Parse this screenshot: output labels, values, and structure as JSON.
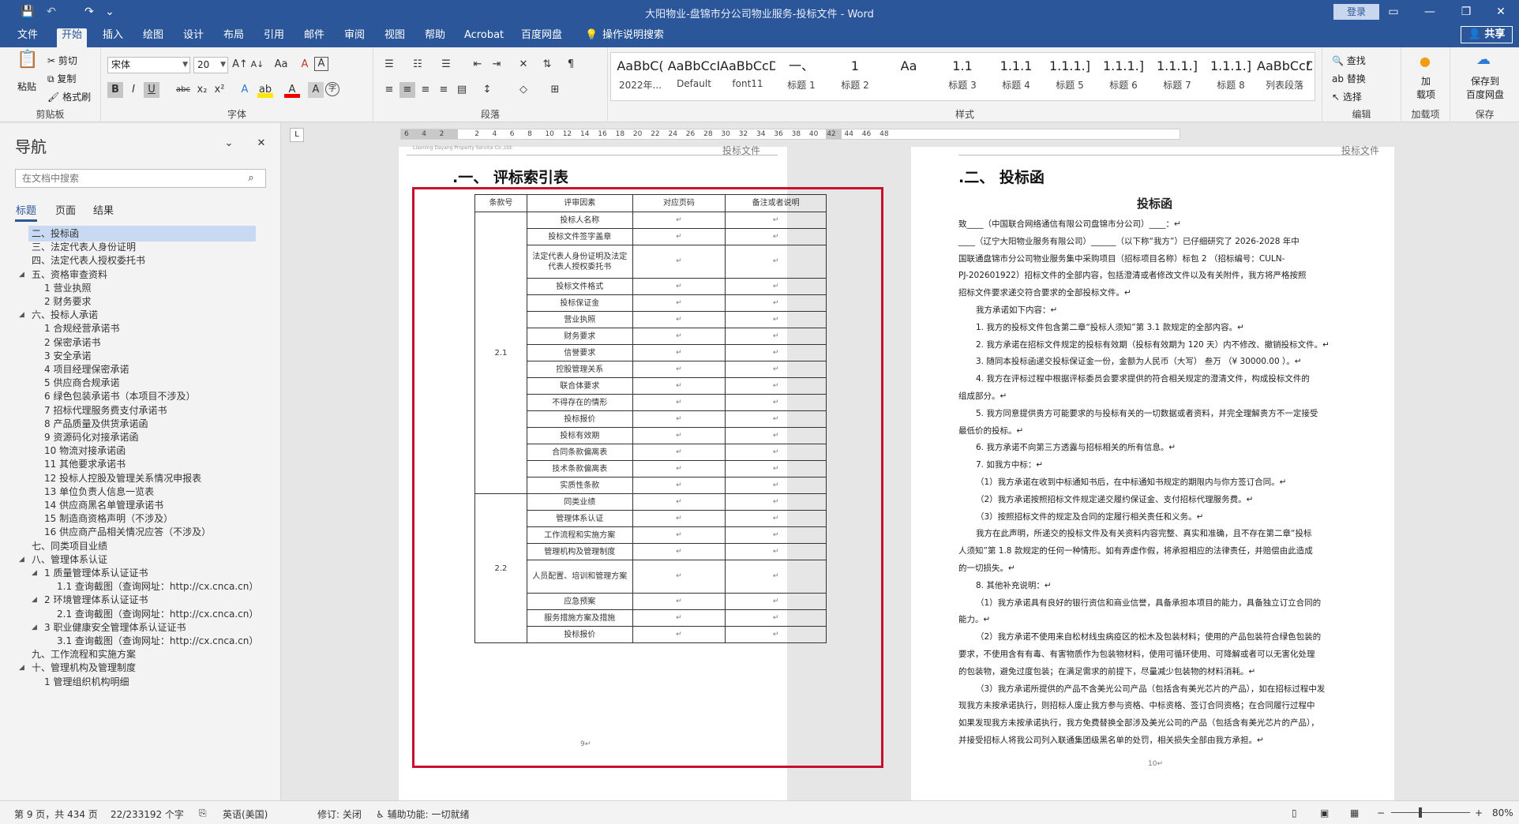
{
  "window": {
    "title": "大阳物业-盘锦市分公司物业服务-投标文件  -  Word",
    "login": "登录",
    "share": "共享"
  },
  "quick_access": {
    "save": "💾",
    "undo": "↶",
    "redo": "↷",
    "more": "⌄"
  },
  "window_buttons": {
    "restore_ribbon": "▭",
    "minimize": "—",
    "maximize": "❐",
    "close": "✕"
  },
  "menu": {
    "file": "文件",
    "home": "开始",
    "insert": "插入",
    "draw": "绘图",
    "design": "设计",
    "layout": "布局",
    "references": "引用",
    "mailings": "邮件",
    "review": "审阅",
    "view": "视图",
    "help": "帮助",
    "acrobat": "Acrobat",
    "baidu": "百度网盘",
    "tellme": "操作说明搜索"
  },
  "ribbon": {
    "clipboard": {
      "paste": "粘贴",
      "cut": "剪切",
      "copy": "复制",
      "format_painter": "格式刷",
      "label": "剪贴板"
    },
    "font": {
      "name": "宋体",
      "size": "20",
      "label": "字体",
      "bold": "B",
      "italic": "I",
      "underline": "U",
      "strike": "abc",
      "sub": "x₂",
      "sup": "x²",
      "grow": "A↑",
      "shrink": "A↓",
      "case": "Aa",
      "clear": "A",
      "textstyle": "A",
      "effect": "A",
      "highlight": "ab",
      "color": "A",
      "shading": "A",
      "enclose": "字"
    },
    "paragraph": {
      "label": "段落"
    },
    "styles": {
      "label": "样式",
      "items": [
        {
          "preview": "AaBbC(",
          "name": "2022年..."
        },
        {
          "preview": "AaBbCcI",
          "name": "Default"
        },
        {
          "preview": "AaBbCcDdI",
          "name": "font11"
        },
        {
          "preview": "一、",
          "name": "标题 1"
        },
        {
          "preview": "1",
          "name": "标题 2"
        },
        {
          "preview": "Aa",
          "name": ""
        },
        {
          "preview": "1.1",
          "name": "标题 3"
        },
        {
          "preview": "1.1.1",
          "name": "标题 4"
        },
        {
          "preview": "1.1.1.]",
          "name": "标题 5"
        },
        {
          "preview": "1.1.1.]",
          "name": "标题 6"
        },
        {
          "preview": "1.1.1.]",
          "name": "标题 7"
        },
        {
          "preview": "1.1.1.]",
          "name": "标题 8"
        },
        {
          "preview": "AaBbCcDdI",
          "name": "列表段落"
        }
      ]
    },
    "editing": {
      "find": "查找",
      "replace": "替换",
      "select": "选择",
      "label": "编辑"
    },
    "addin": {
      "button": "加\n载项",
      "label": "加载项"
    },
    "save": {
      "button": "保存到\n百度网盘",
      "label": "保存"
    }
  },
  "nav": {
    "title": "导航",
    "search_placeholder": "在文档中搜索",
    "tabs": [
      "标题",
      "页面",
      "结果"
    ],
    "items": [
      {
        "text": "二、投标函",
        "level": 0,
        "selected": true
      },
      {
        "text": "三、法定代表人身份证明",
        "level": 0
      },
      {
        "text": "四、法定代表人授权委托书",
        "level": 0
      },
      {
        "text": "五、资格审查资料",
        "level": 0,
        "expand": true
      },
      {
        "text": "1 营业执照",
        "level": 1
      },
      {
        "text": "2 财务要求",
        "level": 1
      },
      {
        "text": "六、投标人承诺",
        "level": 0,
        "expand": true
      },
      {
        "text": "1 合规经营承诺书",
        "level": 1
      },
      {
        "text": "2 保密承诺书",
        "level": 1
      },
      {
        "text": "3 安全承诺",
        "level": 1
      },
      {
        "text": "4 项目经理保密承诺",
        "level": 1
      },
      {
        "text": "5 供应商合规承诺",
        "level": 1
      },
      {
        "text": "6 绿色包装承诺书（本项目不涉及）",
        "level": 1
      },
      {
        "text": "7 招标代理服务费支付承诺书",
        "level": 1
      },
      {
        "text": "8 产品质量及供货承诺函",
        "level": 1
      },
      {
        "text": "9 资源码化对接承诺函",
        "level": 1
      },
      {
        "text": "10 物流对接承诺函",
        "level": 1
      },
      {
        "text": "11 其他要求承诺书",
        "level": 1
      },
      {
        "text": "12 投标人控股及管理关系情况申报表",
        "level": 1
      },
      {
        "text": "13 单位负责人信息一览表",
        "level": 1
      },
      {
        "text": "14 供应商黑名单管理承诺书",
        "level": 1
      },
      {
        "text": "15 制造商资格声明（不涉及）",
        "level": 1
      },
      {
        "text": "16 供应商产品相关情况应答（不涉及）",
        "level": 1
      },
      {
        "text": "七、同类项目业绩",
        "level": 0
      },
      {
        "text": "八、管理体系认证",
        "level": 0,
        "expand": true
      },
      {
        "text": "1 质量管理体系认证证书",
        "level": 1,
        "expand": true
      },
      {
        "text": "1.1 查询截图（查询网址：http://cx.cnca.cn）",
        "level": 2
      },
      {
        "text": "2 环境管理体系认证证书",
        "level": 1,
        "expand": true
      },
      {
        "text": "2.1 查询截图（查询网址：http://cx.cnca.cn）",
        "level": 2
      },
      {
        "text": "3 职业健康安全管理体系认证证书",
        "level": 1,
        "expand": true
      },
      {
        "text": "3.1 查询截图（查询网址：http://cx.cnca.cn）",
        "level": 2
      },
      {
        "text": "九、工作流程和实施方案",
        "level": 0
      },
      {
        "text": "十、管理机构及管理制度",
        "level": 0,
        "expand": true
      },
      {
        "text": "1 管理组织机构明细",
        "level": 1
      }
    ]
  },
  "ruler": [
    "6",
    "4",
    "2",
    "",
    "2",
    "4",
    "6",
    "8",
    "10",
    "12",
    "14",
    "16",
    "18",
    "20",
    "22",
    "24",
    "26",
    "28",
    "30",
    "32",
    "34",
    "36",
    "38",
    "40",
    "42",
    "44",
    "46",
    "48"
  ],
  "page1": {
    "header_right": "投标文件",
    "header_logo": "Liaoning Dayang Property Service Co.,Ltd.",
    "heading": ".一、 评标索引表",
    "table_headers": [
      "条款号",
      "评审因素",
      "对应页码",
      "备注或者说明"
    ],
    "group1_clause": "2.1",
    "group1_rows": [
      "投标人名称",
      "投标文件签字盖章",
      "法定代表人身份证明及法定代表人授权委托书",
      "投标文件格式",
      "投标保证金",
      "营业执照",
      "财务要求",
      "信誉要求",
      "控股管理关系",
      "联合体要求",
      "不得存在的情形",
      "投标报价",
      "投标有效期",
      "合同条款偏离表",
      "技术条款偏离表",
      "实质性条款"
    ],
    "group2_clause": "2.2",
    "group2_rows": [
      "同类业绩",
      "管理体系认证",
      "工作流程和实施方案",
      "管理机构及管理制度",
      "人员配置、培训和管理方案",
      "应急预案",
      "服务措施方案及措施",
      "投标报价"
    ],
    "mark": "↵",
    "page_num": "9↵"
  },
  "page2": {
    "header_right": "投标文件",
    "heading": ".二、 投标函",
    "center_title": "投标函",
    "page_num": "10↵",
    "lines": [
      "致____（中国联合网络通信有限公司盘锦市分公司）____：↵",
      "____（辽宁大阳物业服务有限公司）______（以下称“我方”）已仔细研究了 2026-2028 年中",
      "国联通盘锦市分公司物业服务集中采购项目（招标项目名称）标包 2 （招标编号：CULN-",
      "PJ-202601922）招标文件的全部内容，包括澄清或者修改文件以及有关附件，我方将严格按照",
      "招标文件要求递交符合要求的全部投标文件。↵",
      "我方承诺如下内容：↵",
      "1. 我方的投标文件包含第二章“投标人须知”第 3.1 款规定的全部内容。↵",
      "2. 我方承诺在招标文件规定的投标有效期（投标有效期为 120 天）内不修改、撤销投标文件。↵",
      "3. 随同本投标函递交投标保证金一份，金额为人民币（大写） 叁万 （¥ 30000.00 ）。↵",
      "4. 我方在评标过程中根据评标委员会要求提供的符合相关规定的澄清文件，构成投标文件的",
      "组成部分。↵",
      "5. 我方同意提供贵方可能要求的与投标有关的一切数据或者资料，并完全理解贵方不一定接受",
      "最低价的投标。↵",
      "6. 我方承诺不向第三方透露与招标相关的所有信息。↵",
      "7. 如我方中标：↵",
      "（1）我方承诺在收到中标通知书后，在中标通知书规定的期限内与你方签订合同。↵",
      "（2）我方承诺按照招标文件规定递交履约保证金、支付招标代理服务费。↵",
      "（3）按照招标文件的规定及合同的定履行相关责任和义务。↵",
      "我方在此声明，所递交的投标文件及有关资料内容完整、真实和准确，且不存在第二章“投标",
      "人须知”第 1.8 款规定的任何一种情形。如有弄虚作假，将承担相应的法律责任，并赔偿由此造成",
      "的一切损失。↵",
      "8. 其他补充说明：↵",
      "（1）我方承诺具有良好的银行资信和商业信誉，具备承担本项目的能力，具备独立订立合同的",
      "能力。↵",
      "（2）我方承诺不使用来自松材线虫病疫区的松木及包装材料；使用的产品包装符合绿色包装的",
      "要求，不使用含有有毒、有害物质作为包装物材料，使用可循环使用、可降解或者可以无害化处理",
      "的包装物，避免过度包装；在满足需求的前提下，尽量减少包装物的材料消耗。↵",
      "（3）我方承诺所提供的产品不含美光公司产品（包括含有美光芯片的产品），如在招标过程中发",
      "现我方未按承诺执行，则招标人废止我方参与资格、中标资格、签订合同资格；在合同履行过程中",
      "如果发现我方未按承诺执行，我方免费替换全部涉及美光公司的产品（包括含有美光芯片的产品），",
      "并接受招标人将我公司列入联通集团级黑名单的处罚，相关损失全部由我方承担。↵"
    ]
  },
  "status": {
    "page": "第 9 页，共 434 页",
    "words": "22/233192 个字",
    "lang": "英语(美国)",
    "track": "修订: 关闭",
    "access": "辅助功能: 一切就绪",
    "zoom": "80%"
  }
}
